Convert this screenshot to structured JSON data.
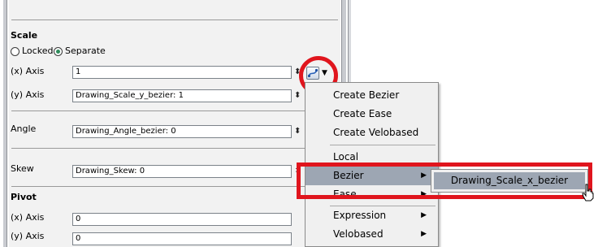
{
  "scale": {
    "title": "Scale",
    "locked_label": "Locked",
    "separate_label": "Separate",
    "x_axis_label": "(x) Axis",
    "x_axis_value": "1",
    "y_axis_label": "(y) Axis",
    "y_axis_value": "Drawing_Scale_y_bezier: 1"
  },
  "angle": {
    "label": "Angle",
    "value": "Drawing_Angle_bezier: 0"
  },
  "skew": {
    "label": "Skew",
    "value": "Drawing_Skew: 0"
  },
  "pivot": {
    "title": "Pivot",
    "x_axis_label": "(x) Axis",
    "x_axis_value": "0",
    "y_axis_label": "(y) Axis",
    "y_axis_value": "0"
  },
  "spinner_glyph": "⬍",
  "menu": {
    "items": [
      {
        "label": "Create Bezier"
      },
      {
        "label": "Create Ease"
      },
      {
        "label": "Create Velobased"
      },
      {
        "label": "Local"
      },
      {
        "label": "Bezier"
      },
      {
        "label": "Ease"
      },
      {
        "label": "Expression"
      },
      {
        "label": "Velobased"
      }
    ]
  },
  "submenu": {
    "item": "Drawing_Scale_x_bezier"
  },
  "colors": {
    "highlight_red": "#e0151d",
    "menu_active": "#9da6b3",
    "radio_dot": "#2f8c5c"
  },
  "icons": {
    "function": "curve-function-icon",
    "submenu_arrow": "triangle-right-icon"
  }
}
